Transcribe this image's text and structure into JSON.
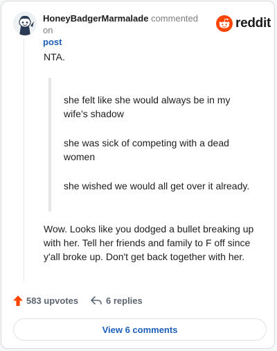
{
  "header": {
    "username": "HoneyBadgerMarmalade",
    "action_text": "commented on",
    "post_link": "post",
    "brand": "reddit"
  },
  "comment": {
    "opening": "NTA.",
    "quotes": [
      "she felt like she would always be in my wife’s shadow",
      "she was sick of competing with a dead women",
      "she wished we would all get over it already."
    ],
    "body": "Wow. Looks like you dodged a bullet breaking up with her. Tell her friends and family to F off since y'all broke up. Don't get back together with her."
  },
  "footer": {
    "upvotes": "583 upvotes",
    "replies": "6 replies",
    "view_comments": "View 6 comments"
  },
  "colors": {
    "upvote_arrow": "#ff4500",
    "link_blue": "#1d5fb8",
    "reddit_orange": "#ff4500"
  },
  "icons": {
    "avatar": "snoo-avatar",
    "logo": "reddit-snoo-icon",
    "upvote": "upvote-arrow-icon",
    "reply": "reply-arrow-icon"
  }
}
